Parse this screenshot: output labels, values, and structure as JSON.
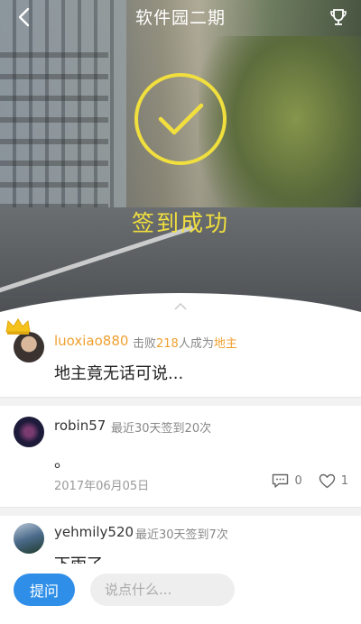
{
  "header": {
    "title": "软件园二期",
    "back_icon": "chevron-left-icon",
    "trophy_icon": "trophy-icon"
  },
  "hero": {
    "success_text": "签到成功",
    "check_icon": "checkmark-circle-icon",
    "accent_color": "#f1df3e"
  },
  "posts": [
    {
      "username": "luoxiao880",
      "badge": "crown-icon",
      "meta": {
        "prefix": "击败",
        "count": "218",
        "middle": "人成为",
        "title": "地主"
      },
      "content": "地主竟无话可说..."
    },
    {
      "username": "robin57",
      "meta_text": "最近30天签到20次",
      "content": "。",
      "date": "2017年06月05日",
      "comment_count": "0",
      "like_count": "1"
    },
    {
      "username": "yehmily520",
      "meta_text": "最近30天签到7次",
      "content": "下雨了"
    }
  ],
  "bottom_bar": {
    "ask_label": "提问",
    "input_placeholder": "说点什么...",
    "accent_color": "#2f8fe8"
  }
}
